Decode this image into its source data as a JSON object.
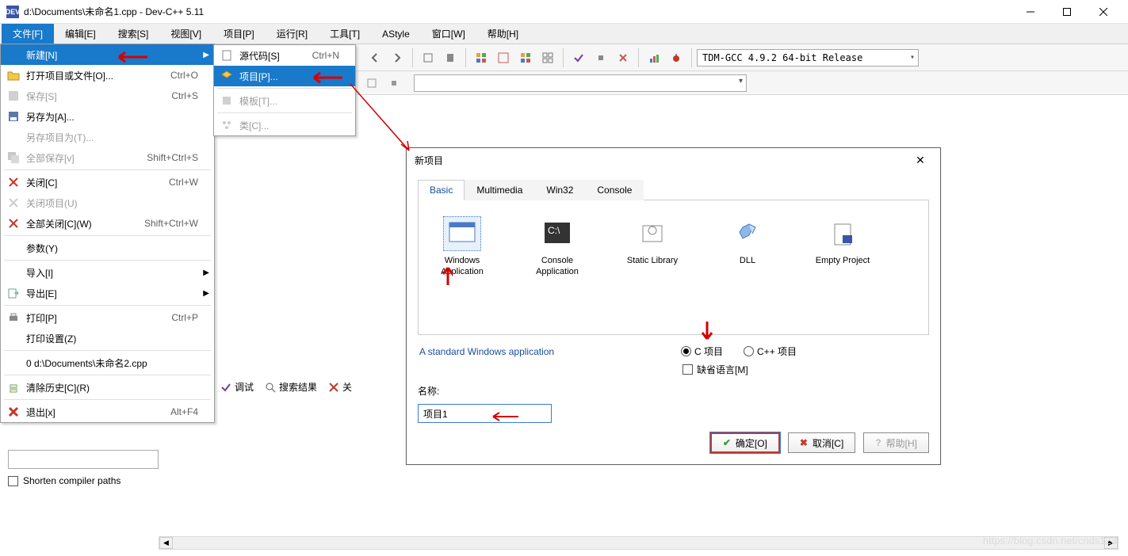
{
  "window": {
    "title": "d:\\Documents\\未命名1.cpp - Dev-C++ 5.11"
  },
  "menubar": [
    "文件[F]",
    "编辑[E]",
    "搜索[S]",
    "视图[V]",
    "项目[P]",
    "运行[R]",
    "工具[T]",
    "AStyle",
    "窗口[W]",
    "帮助[H]"
  ],
  "compiler_combo": "TDM-GCC 4.9.2 64-bit Release",
  "file_menu": {
    "new": {
      "label": "新建[N]",
      "shortcut": ""
    },
    "open": {
      "label": "打开项目或文件[O]...",
      "shortcut": "Ctrl+O"
    },
    "save": {
      "label": "保存[S]",
      "shortcut": "Ctrl+S"
    },
    "save_as": {
      "label": "另存为[A]...",
      "shortcut": ""
    },
    "save_proj_as": {
      "label": "另存项目为(T)...",
      "shortcut": ""
    },
    "save_all": {
      "label": "全部保存[v]",
      "shortcut": "Shift+Ctrl+S"
    },
    "close": {
      "label": "关闭[C]",
      "shortcut": "Ctrl+W"
    },
    "close_proj": {
      "label": "关闭项目(U)",
      "shortcut": ""
    },
    "close_all": {
      "label": "全部关闭[C](W)",
      "shortcut": "Shift+Ctrl+W"
    },
    "params": {
      "label": "参数(Y)",
      "shortcut": ""
    },
    "import": {
      "label": "导入[I]",
      "shortcut": ""
    },
    "export": {
      "label": "导出[E]",
      "shortcut": ""
    },
    "print": {
      "label": "打印[P]",
      "shortcut": "Ctrl+P"
    },
    "print_setup": {
      "label": "打印设置(Z)",
      "shortcut": ""
    },
    "recent0": {
      "label": "0 d:\\Documents\\未命名2.cpp",
      "shortcut": ""
    },
    "clear_hist": {
      "label": "清除历史[C](R)",
      "shortcut": ""
    },
    "exit": {
      "label": "退出[x]",
      "shortcut": "Alt+F4"
    }
  },
  "new_submenu": {
    "source": {
      "label": "源代码[S]",
      "shortcut": "Ctrl+N"
    },
    "project": {
      "label": "项目[P]...",
      "shortcut": ""
    },
    "template": {
      "label": "模板[T]...",
      "shortcut": ""
    },
    "class": {
      "label": "类[C]...",
      "shortcut": ""
    }
  },
  "dialog": {
    "title": "新项目",
    "tabs": [
      "Basic",
      "Multimedia",
      "Win32",
      "Console"
    ],
    "types": [
      {
        "name": "Windows Application"
      },
      {
        "name": "Console Application"
      },
      {
        "name": "Static Library"
      },
      {
        "name": "DLL"
      },
      {
        "name": "Empty Project"
      }
    ],
    "description": "A standard Windows application",
    "radio_c": "C 项目",
    "radio_cpp": "C++ 项目",
    "check_default": "缺省语言[M]",
    "name_label": "名称:",
    "name_value": "项目1",
    "ok": "确定[O]",
    "cancel": "取消[C]",
    "help": "帮助[H]"
  },
  "bottom_tabs": {
    "debug": "调试",
    "search": "搜索结果",
    "close": "关"
  },
  "shorten": "Shorten compiler paths",
  "watermark": "https://blog.csdn.net/cnds123"
}
